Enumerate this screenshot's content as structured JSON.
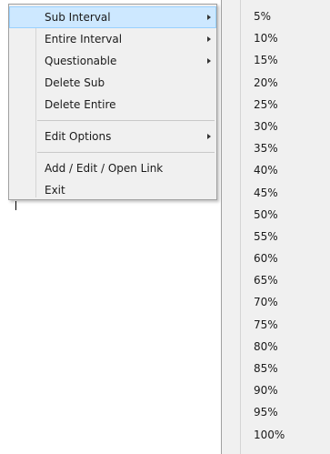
{
  "context_menu": {
    "items": [
      {
        "label": "Sub Interval",
        "has_submenu": true,
        "highlighted": true
      },
      {
        "label": "Entire Interval",
        "has_submenu": true
      },
      {
        "label": "Questionable",
        "has_submenu": true
      },
      {
        "label": "Delete Sub",
        "has_submenu": false
      },
      {
        "label": "Delete Entire",
        "has_submenu": false
      },
      {
        "label": "Edit Options",
        "has_submenu": true
      },
      {
        "label": "Add / Edit / Open Link",
        "has_submenu": false
      },
      {
        "label": "Exit",
        "has_submenu": false
      }
    ]
  },
  "submenu": {
    "items": [
      "5%",
      "10%",
      "15%",
      "20%",
      "25%",
      "30%",
      "35%",
      "40%",
      "45%",
      "50%",
      "55%",
      "60%",
      "65%",
      "70%",
      "75%",
      "80%",
      "85%",
      "90%",
      "95%",
      "100%"
    ]
  },
  "colors": {
    "menu_background": "#f0f0f0",
    "highlight_background": "#cde8ff",
    "highlight_border": "#99d1ff",
    "menu_border": "#a0a0a0"
  },
  "icons": {
    "submenu_arrow": "chevron-right-icon"
  }
}
